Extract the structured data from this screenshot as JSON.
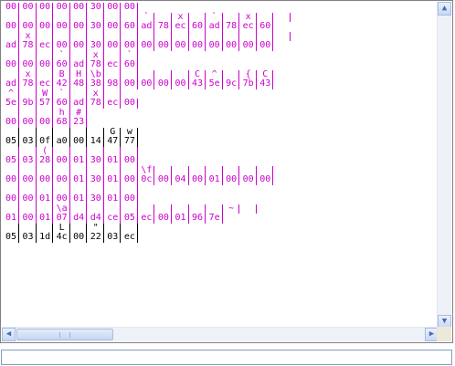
{
  "colors": {
    "rx": "#cc00cc",
    "tx": "#000000",
    "sep_rx": "#cc00cc",
    "sep_tx": "#000000"
  },
  "rows": [
    {
      "type": "hex",
      "dir": "rx",
      "cells": [
        "00",
        "00",
        "00",
        "00",
        "00",
        "30",
        "00",
        "00"
      ]
    },
    {
      "type": "asc",
      "dir": "rx",
      "cells": [
        "",
        "",
        "",
        "",
        "",
        "",
        "",
        "",
        "`",
        "",
        "x",
        "",
        "`",
        "",
        "x",
        "",
        ""
      ]
    },
    {
      "type": "hex",
      "dir": "rx",
      "cells": [
        "00",
        "00",
        "00",
        "00",
        "00",
        "30",
        "00",
        "60",
        "ad",
        "78",
        "ec",
        "60",
        "ad",
        "78",
        "ec",
        "60"
      ]
    },
    {
      "type": "asc",
      "dir": "rx",
      "cells": [
        "",
        "x",
        "",
        "",
        "",
        "",
        "",
        "",
        "",
        "",
        "",
        "",
        "",
        "",
        "",
        "",
        ""
      ]
    },
    {
      "type": "hex",
      "dir": "rx",
      "cells": [
        "ad",
        "78",
        "ec",
        "00",
        "00",
        "30",
        "00",
        "00",
        "00",
        "00",
        "00",
        "00",
        "00",
        "00",
        "00",
        "00"
      ]
    },
    {
      "type": "asc",
      "dir": "rx",
      "cells": [
        "",
        "",
        "",
        "`",
        "",
        "x",
        "",
        "`"
      ]
    },
    {
      "type": "hex",
      "dir": "rx",
      "cells": [
        "00",
        "00",
        "00",
        "60",
        "ad",
        "78",
        "ec",
        "60"
      ]
    },
    {
      "type": "asc",
      "dir": "rx",
      "cells": [
        "",
        "x",
        "",
        "B",
        "H",
        "\\b",
        "",
        "",
        "",
        "",
        "",
        "C",
        "^",
        "",
        "{",
        "C"
      ]
    },
    {
      "type": "hex",
      "dir": "rx",
      "cells": [
        "ad",
        "78",
        "ec",
        "42",
        "48",
        "38",
        "98",
        "00",
        "00",
        "00",
        "00",
        "43",
        "5e",
        "9c",
        "7b",
        "43"
      ]
    },
    {
      "type": "asc",
      "dir": "rx",
      "cells": [
        "^",
        "",
        "W",
        "`",
        "",
        "x",
        ""
      ]
    },
    {
      "type": "hex",
      "dir": "rx",
      "cells": [
        "5e",
        "9b",
        "57",
        "60",
        "ad",
        "78",
        "ec",
        "00"
      ]
    },
    {
      "type": "asc",
      "dir": "rx",
      "cells": [
        "",
        "",
        "",
        "h",
        "#"
      ]
    },
    {
      "type": "hex",
      "dir": "rx",
      "cells": [
        "00",
        "00",
        "00",
        "68",
        "23"
      ]
    },
    {
      "type": "asc",
      "dir": "tx",
      "cells": [
        "",
        "",
        "",
        "",
        "",
        "",
        "G",
        "w"
      ]
    },
    {
      "type": "hex",
      "dir": "tx",
      "cells": [
        "05",
        "03",
        "0f",
        "a0",
        "00",
        "14",
        "47",
        "77"
      ]
    },
    {
      "type": "asc",
      "dir": "rx",
      "cells": [
        "",
        "",
        "(",
        "",
        "",
        "",
        "",
        ""
      ]
    },
    {
      "type": "hex",
      "dir": "rx",
      "cells": [
        "05",
        "03",
        "28",
        "00",
        "01",
        "30",
        "01",
        "00"
      ]
    },
    {
      "type": "asc",
      "dir": "rx",
      "cells": [
        "",
        "",
        "",
        "",
        "",
        "",
        "",
        "",
        "\\f",
        "",
        "",
        "",
        "",
        "",
        "",
        ""
      ]
    },
    {
      "type": "hex",
      "dir": "rx",
      "cells": [
        "00",
        "00",
        "00",
        "00",
        "01",
        "30",
        "01",
        "00",
        "0c",
        "00",
        "04",
        "00",
        "01",
        "00",
        "00",
        "00"
      ]
    },
    {
      "type": "asc",
      "dir": "rx",
      "cells": [
        "",
        "",
        "",
        "",
        "",
        "",
        "",
        ""
      ]
    },
    {
      "type": "hex",
      "dir": "rx",
      "cells": [
        "00",
        "00",
        "01",
        "00",
        "01",
        "30",
        "01",
        "00"
      ]
    },
    {
      "type": "asc",
      "dir": "rx",
      "cells": [
        "",
        "",
        "",
        "\\a",
        "",
        "",
        "",
        "",
        "",
        "",
        "",
        "",
        "",
        "~",
        ""
      ]
    },
    {
      "type": "hex",
      "dir": "rx",
      "cells": [
        "01",
        "00",
        "01",
        "07",
        "d4",
        "d4",
        "ce",
        "05",
        "ec",
        "00",
        "01",
        "96",
        "7e"
      ]
    },
    {
      "type": "asc",
      "dir": "tx",
      "cells": [
        "",
        "",
        "",
        "L",
        "",
        "\"",
        "",
        ""
      ]
    },
    {
      "type": "hex",
      "dir": "tx",
      "cells": [
        "05",
        "03",
        "1d",
        "4c",
        "00",
        "22",
        "03",
        "ec"
      ]
    }
  ],
  "icons": {
    "scroll_up": "scroll-up-arrow",
    "scroll_down": "scroll-down-arrow",
    "scroll_left": "scroll-left-arrow",
    "scroll_right": "scroll-right-arrow"
  },
  "input_value": ""
}
